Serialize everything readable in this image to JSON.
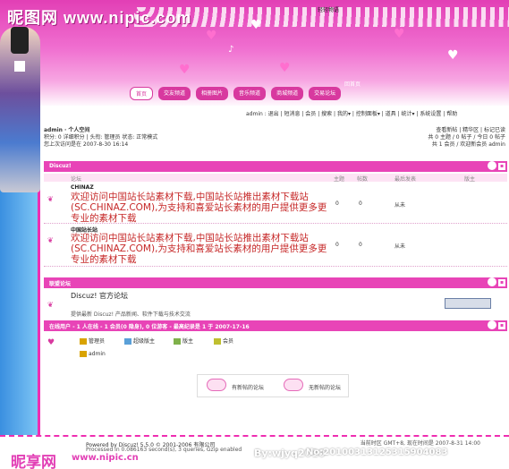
{
  "watermark": {
    "top": "昵图网 www.nipic.com",
    "bottom_logo": "昵享网",
    "bottom_url": "www.nipic.cn",
    "by": "By:wjyq2010",
    "num": "No:20100313125315904083"
  },
  "header": {
    "title": "轻轻物语",
    "sub": "回首页"
  },
  "nav": [
    "首页",
    "交友频道",
    "相册图片",
    "音乐频道",
    "商城频道",
    "交易论坛"
  ],
  "topnav": "admin : 退出 | 短消息 | 会员 | 搜索 | 我的▾ | 控制面板▾ | 道具 | 统计▾ | 系统设置 | 帮助",
  "user": {
    "line1": "admin · 个人空间",
    "line2": "积分: 0 详细积分 | 头衔: 管理员  状态: 正常模式",
    "line3": "您上次访问是在 2007-8-30 16:14"
  },
  "right": {
    "line1": "查看新帖 | 精华区 | 标记已读",
    "line2": "共 0 主题 / 0 帖子 / 今日 0 帖子",
    "line3": "共 1 会员 / 欢迎新会员 admin"
  },
  "section1": {
    "title": "Discuz!"
  },
  "table": {
    "col_forum": "论坛",
    "col_topics": "主题",
    "col_posts": "帖数",
    "col_last": "最后发表",
    "col_mod": "版主"
  },
  "forums": [
    {
      "name": "CHINAZ",
      "desc": "欢迎访问中国站长站素材下载,中国站长站推出素材下载站(SC.CHINAZ.COM),为支持和喜爱站长素材的用户提供更多更专业的素材下载",
      "topics": "0",
      "posts": "0",
      "last": "从未"
    },
    {
      "name": "中国站长站",
      "desc": "欢迎访问中国站长站素材下载,中国站长站推出素材下载站(SC.CHINAZ.COM),为支持和喜爱站长素材的用户提供更多更专业的素材下载",
      "topics": "0",
      "posts": "0",
      "last": "从未"
    }
  ],
  "section2": {
    "title": "联盟论坛"
  },
  "friend": {
    "title": "Discuz! 官方论坛",
    "sub": "提供最新 Discuz! 产品新闻、软件下载与技术交流"
  },
  "online": {
    "title": "在线用户 - 1 人在线 - 1 会员(0 隐身), 0 位游客 - 最高纪录是 1 于 2007-17-16"
  },
  "legend": [
    "管理员",
    "超级版主",
    "版主",
    "会员"
  ],
  "online_user": "admin",
  "status_boxes": {
    "new": "有新帖的论坛",
    "none": "无新帖的论坛"
  },
  "footer": {
    "f1": "Powered by Discuz! 5.5.0 © 2001-2006 有限公司",
    "f2": "Processed in 0.086163 second(s), 3 queries, Gzip enabled",
    "right": "当前时区 GMT+8, 现在时间是 2007-8-31 14:00"
  }
}
